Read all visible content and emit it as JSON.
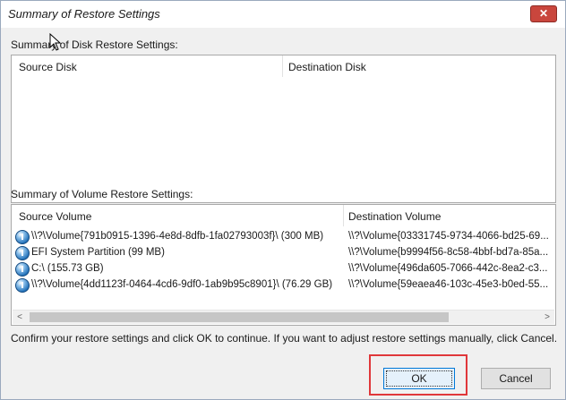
{
  "window": {
    "title": "Summary of Restore Settings",
    "close_glyph": "✕"
  },
  "disk_section": {
    "label": "Summary of Disk Restore Settings:",
    "columns": [
      "Source Disk",
      "Destination Disk"
    ]
  },
  "volume_section": {
    "label": "Summary of Volume Restore Settings:",
    "columns": [
      "Source Volume",
      "Destination Volume"
    ],
    "rows": [
      {
        "source": "\\\\?\\Volume{791b0915-1396-4e8d-8dfb-1fa02793003f}\\ (300 MB)",
        "destination": "\\\\?\\Volume{03331745-9734-4066-bd25-69..."
      },
      {
        "source": "EFI System Partition (99 MB)",
        "destination": "\\\\?\\Volume{b9994f56-8c58-4bbf-bd7a-85a..."
      },
      {
        "source": "C:\\ (155.73 GB)",
        "destination": "\\\\?\\Volume{496da605-7066-442c-8ea2-c3..."
      },
      {
        "source": "\\\\?\\Volume{4dd1123f-0464-4cd6-9df0-1ab9b95c8901}\\ (76.29 GB)",
        "destination": "\\\\?\\Volume{59eaea46-103c-45e3-b0ed-55..."
      }
    ],
    "scroll_left_glyph": "<",
    "scroll_right_glyph": ">"
  },
  "instructions": "Confirm your restore settings and click OK to continue. If you want to adjust restore settings manually, click Cancel.",
  "buttons": {
    "ok": "OK",
    "cancel": "Cancel"
  },
  "colors": {
    "highlight": "#e0373a",
    "volume_icon": "#1f6fb8"
  },
  "icons": {
    "volume": "volume-icon",
    "close": "close-icon",
    "cursor": "mouse-pointer-icon"
  }
}
